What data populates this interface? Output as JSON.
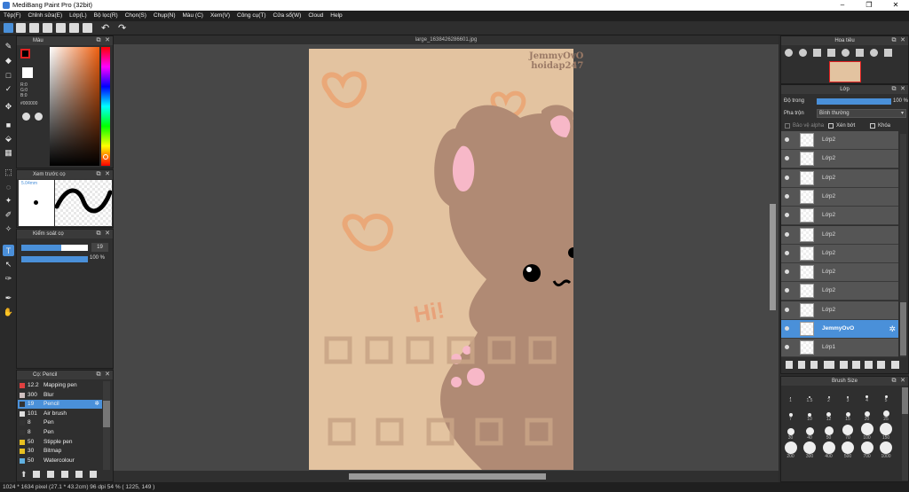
{
  "window": {
    "title": "MediBang Paint Pro (32bit)"
  },
  "menu": [
    "Tệp(F)",
    "Chỉnh sửa(E)",
    "Lớp(L)",
    "Bộ lọc(R)",
    "Chọn(S)",
    "Chụp(N)",
    "Màu (C)",
    "Xem(V)",
    "Công cụ(T)",
    "Cửa sổ(W)",
    "Cloud",
    "Help"
  ],
  "document": {
    "tab_title": "large_1638426286601.jpg",
    "watermark_line1": "JemmyOvO",
    "watermark_line2": "hoidap247",
    "hi_text": "Hi!"
  },
  "color_panel": {
    "title": "Màu",
    "r": "R:0",
    "g": "G:0",
    "b": "B:0",
    "hex": "#000000",
    "color": "#000000"
  },
  "brush_preview": {
    "title": "Xem trước cọ",
    "size": "5.04mm"
  },
  "brush_control": {
    "title": "Kiểm soát cọ",
    "size_value": "19",
    "opacity_value": "100 %",
    "size_fraction": 0.6,
    "opacity_fraction": 1.0
  },
  "brush_list": {
    "title": "Cọ: Pencil",
    "items": [
      {
        "size": "12.2",
        "name": "Mapping pen",
        "color": "#e04040"
      },
      {
        "size": "300",
        "name": "Blur",
        "color": "#d0c0c0"
      },
      {
        "size": "19",
        "name": "Pencil",
        "color": "#333333",
        "selected": true
      },
      {
        "size": "101",
        "name": "Air brush",
        "color": "#dddddd"
      },
      {
        "size": "8",
        "name": "Pen",
        "color": "#333333"
      },
      {
        "size": "8",
        "name": "Pen",
        "color": "#333333"
      },
      {
        "size": "50",
        "name": "Stipple pen",
        "color": "#e8c020"
      },
      {
        "size": "30",
        "name": "Bitmap",
        "color": "#e8c020"
      },
      {
        "size": "50",
        "name": "Watercolour",
        "color": "#60b0e0"
      }
    ]
  },
  "navigator": {
    "title": "Hoa tiêu"
  },
  "layers": {
    "title": "Lớp",
    "opacity_label": "Độ trong",
    "opacity_value": "100 %",
    "blend_label": "Pha trộn",
    "blend_value": "Bình thường",
    "protect_alpha": "Bảo vệ alpha",
    "clipping": "Xén bớt",
    "lock": "Khóa",
    "items": [
      {
        "name": "Lớp2"
      },
      {
        "name": "Lớp2"
      },
      {
        "name": "Lớp2"
      },
      {
        "name": "Lớp2"
      },
      {
        "name": "Lớp2"
      },
      {
        "name": "Lớp2"
      },
      {
        "name": "Lớp2"
      },
      {
        "name": "Lớp2"
      },
      {
        "name": "Lớp2"
      },
      {
        "name": "Lớp2"
      },
      {
        "name": "JemmyOvO",
        "selected": true
      },
      {
        "name": "Lớp1"
      }
    ]
  },
  "brush_size": {
    "title": "Brush Size",
    "sizes": [
      "1",
      "1.5",
      "2",
      "3",
      "4",
      "5",
      "7",
      "10",
      "12",
      "15",
      "20",
      "25",
      "30",
      "40",
      "50",
      "70",
      "100",
      "150",
      "200",
      "300",
      "400",
      "500",
      "700",
      "1000"
    ]
  },
  "status": {
    "text": "1024 * 1634 pixel   (27.1 * 43.2cm)   96 dpi   54 %   ( 1225, 149 )"
  }
}
